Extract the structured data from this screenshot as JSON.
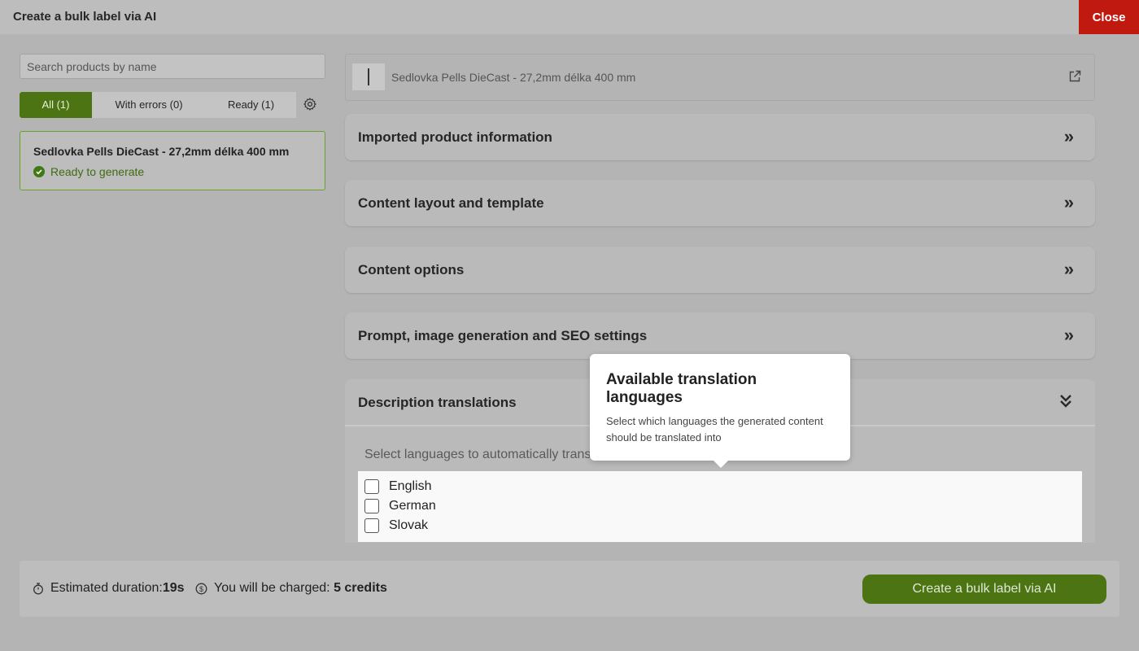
{
  "window": {
    "title": "Create a bulk label via AI",
    "close_label": "Close"
  },
  "search": {
    "placeholder": "Search products by name",
    "value": ""
  },
  "filters": {
    "all": "All (1)",
    "errors": "With errors (0)",
    "ready": "Ready (1)",
    "settings_icon": "gear-icon"
  },
  "product_list": [
    {
      "name": "Sedlovka Pells DieCast - 27,2mm délka 400 mm",
      "status": "Ready to generate",
      "status_icon": "check-circle-icon"
    }
  ],
  "selected_product": {
    "name": "Sedlovka Pells DieCast - 27,2mm délka 400 mm",
    "open_icon": "external-link-icon"
  },
  "sections": {
    "imported": "Imported product information",
    "layout": "Content layout and template",
    "options": "Content options",
    "prompt": "Prompt, image generation and SEO settings",
    "translations": "Description translations"
  },
  "translations": {
    "prompt": "Select languages to automatically transl",
    "languages": [
      {
        "label": "English",
        "checked": false
      },
      {
        "label": "German",
        "checked": false
      },
      {
        "label": "Slovak",
        "checked": false
      }
    ]
  },
  "tooltip": {
    "title": "Available translation languages",
    "description": "Select which languages the generated content should be translated into"
  },
  "footer": {
    "duration_label": "Estimated duration:",
    "duration_value": "19s",
    "charge_label": "You will be charged: ",
    "charge_value": "5 credits",
    "create_button": "Create a bulk label via AI"
  },
  "colors": {
    "accent_green": "#4c7413",
    "close_red": "#c01a10",
    "ready_green": "#3f6b10"
  }
}
